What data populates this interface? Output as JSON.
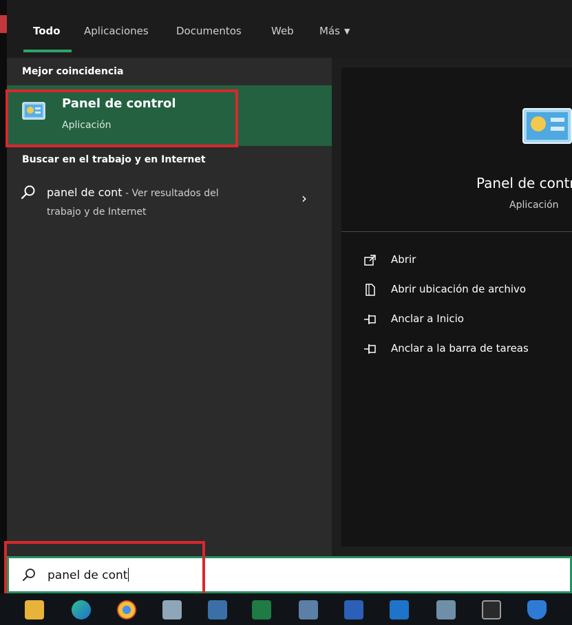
{
  "tabs": {
    "todo": "Todo",
    "aplicaciones": "Aplicaciones",
    "documentos": "Documentos",
    "web": "Web",
    "mas": "Más"
  },
  "left": {
    "best_match_heading": "Mejor coincidencia",
    "best_match": {
      "title": "Panel de control",
      "subtitle": "Aplicación"
    },
    "web_heading": "Buscar en el trabajo y en Internet",
    "web_result": {
      "query": "panel de cont",
      "suffix": " - Ver resultados del",
      "line2": "trabajo y de Internet"
    }
  },
  "right": {
    "title": "Panel de control",
    "subtitle": "Aplicación",
    "actions": [
      {
        "label": "Abrir",
        "icon": "open-icon"
      },
      {
        "label": "Abrir ubicación de archivo",
        "icon": "file-location-icon"
      },
      {
        "label": "Anclar a Inicio",
        "icon": "pin-icon"
      },
      {
        "label": "Anclar a la barra de tareas",
        "icon": "pin-icon"
      }
    ]
  },
  "search": {
    "value": "panel de cont"
  },
  "taskbar": {
    "apps": [
      "file-explorer-icon",
      "edge-icon",
      "chrome-icon",
      "app-icon",
      "calculator-icon",
      "excel-icon",
      "network-icon",
      "word-icon",
      "outlook-icon",
      "notepad-icon",
      "terminal-icon",
      "shield-icon"
    ]
  },
  "colors": {
    "accent_green": "#236140",
    "tab_underline": "#2ea36b",
    "annotation_red": "#d8282e",
    "search_border": "#26915e"
  }
}
